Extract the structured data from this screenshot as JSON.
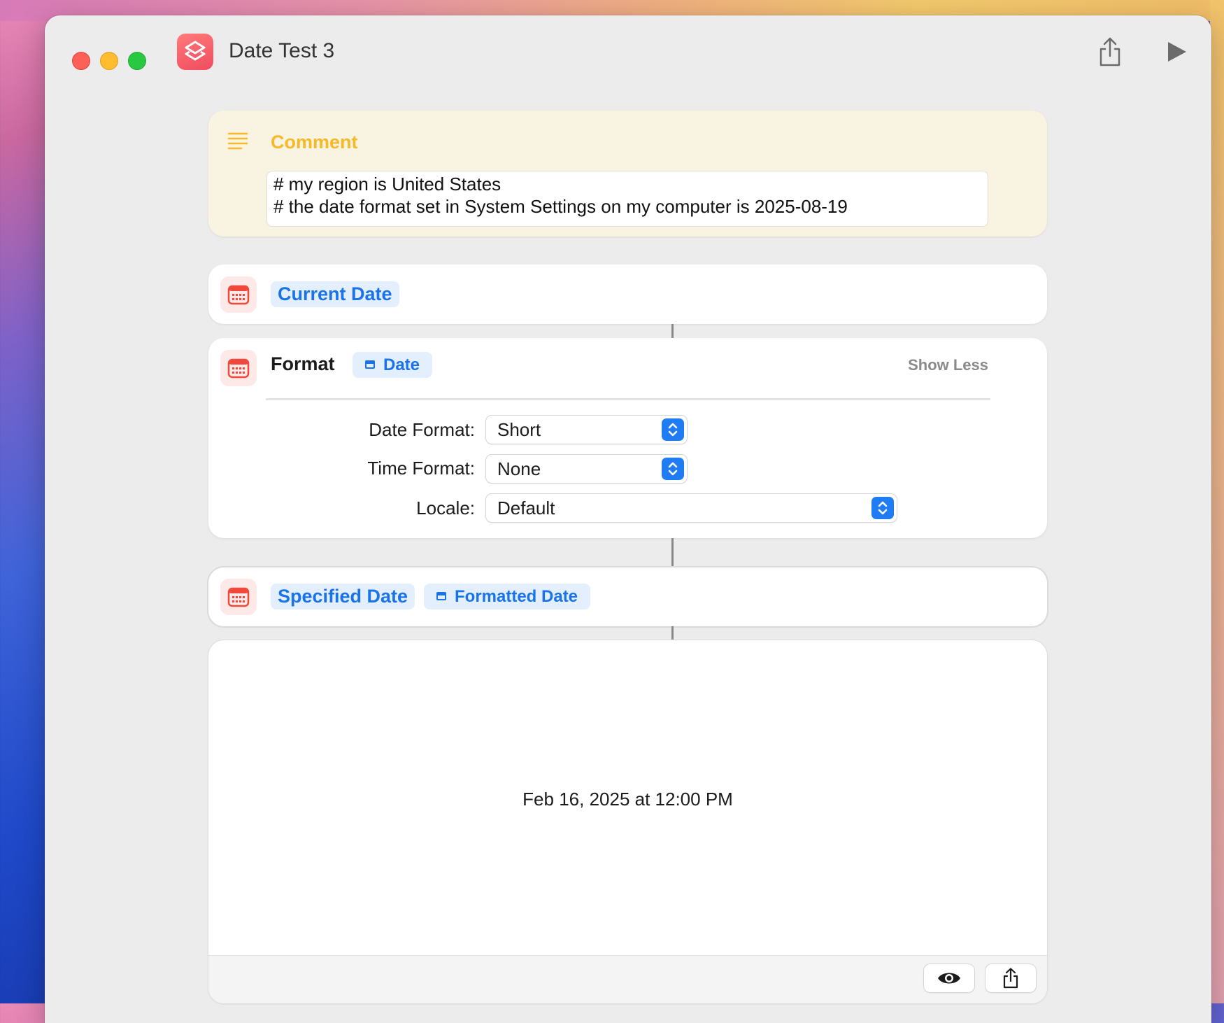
{
  "window": {
    "title": "Date Test 3"
  },
  "comment": {
    "label": "Comment",
    "lines": [
      "# my region is United States",
      "# the date format set in System Settings on my computer is 2025-08-19"
    ]
  },
  "current_date": {
    "label": "Current Date"
  },
  "format": {
    "label": "Format",
    "variable": "Date",
    "toggle": "Show Less",
    "params": {
      "date_format": {
        "label": "Date Format:",
        "value": "Short"
      },
      "time_format": {
        "label": "Time Format:",
        "value": "None"
      },
      "locale": {
        "label": "Locale:",
        "value": "Default"
      }
    }
  },
  "specified_date": {
    "label": "Specified Date",
    "variable": "Formatted Date"
  },
  "result": {
    "text": "Feb 16, 2025 at 12:00 PM"
  },
  "colors": {
    "accent_blue": "#1a73e8",
    "comment_yellow": "#f7b928",
    "calendar_red": "#f0483c",
    "close": "#fe5f57",
    "minimize": "#febc2e",
    "maximize": "#28c840"
  },
  "icons": {
    "app": "shortcuts-icon",
    "share": "share-icon",
    "run": "play-icon",
    "comment": "text-lines-icon",
    "calendar": "calendar-icon",
    "preview": "eye-icon"
  }
}
